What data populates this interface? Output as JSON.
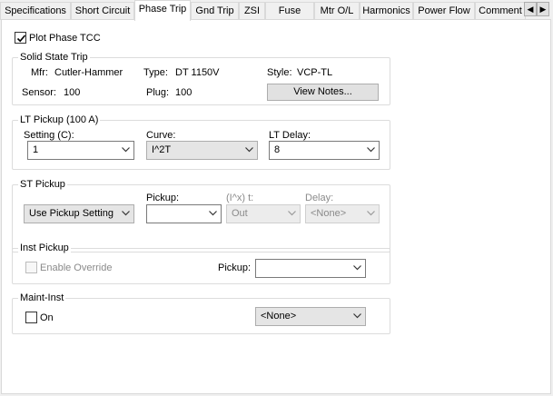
{
  "tabs": [
    {
      "label": "Specifications",
      "active": false
    },
    {
      "label": "Short Circuit",
      "active": false
    },
    {
      "label": "Phase Trip",
      "active": true
    },
    {
      "label": "Gnd Trip",
      "active": false
    },
    {
      "label": "ZSI",
      "active": false
    },
    {
      "label": "Fuse",
      "active": false
    },
    {
      "label": "Mtr O/L",
      "active": false
    },
    {
      "label": "Harmonics",
      "active": false
    },
    {
      "label": "Power Flow",
      "active": false
    },
    {
      "label": "Comment",
      "active": false
    }
  ],
  "tab_scroll": {
    "left": "◀",
    "right": "▶"
  },
  "plot_phase_tcc": {
    "label": "Plot Phase TCC",
    "checked": true
  },
  "solid_state_trip": {
    "title": "Solid State Trip",
    "mfr_label": "Mfr:",
    "mfr_value": "Cutler-Hammer",
    "type_label": "Type:",
    "type_value": "DT 1150V",
    "style_label": "Style:",
    "style_value": "VCP-TL",
    "sensor_label": "Sensor:",
    "sensor_value": "100",
    "plug_label": "Plug:",
    "plug_value": "100",
    "view_notes_label": "View Notes..."
  },
  "lt_pickup": {
    "title": "LT Pickup (100 A)",
    "setting_label": "Setting (C):",
    "setting_value": "1",
    "curve_label": "Curve:",
    "curve_value": "I^2T",
    "delay_label": "LT Delay:",
    "delay_value": "8"
  },
  "st_pickup": {
    "title": "ST Pickup",
    "mode_value": "Use Pickup Setting",
    "pickup_label": "Pickup:",
    "pickup_value": "",
    "curve_label": "(I^x) t:",
    "curve_value": "Out",
    "delay_label": "Delay:",
    "delay_value": "<None>"
  },
  "inst_pickup": {
    "title": "Inst Pickup",
    "override_label": "Enable Override",
    "override_checked": false,
    "pickup_label": "Pickup:",
    "pickup_value": ""
  },
  "maint_inst": {
    "title": "Maint-Inst",
    "on_label": "On",
    "on_checked": false,
    "value": "<None>"
  }
}
